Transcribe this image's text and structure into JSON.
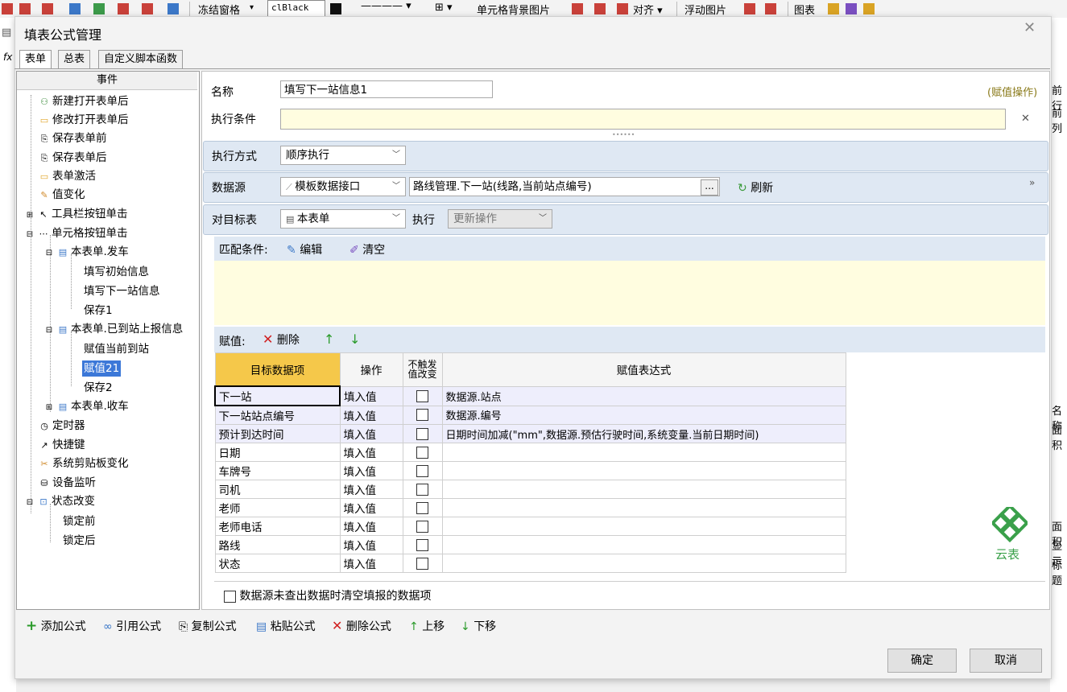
{
  "bg_toolbar": {
    "freeze_label": "冻结窗格",
    "color_value": "clBlack",
    "cell_bg_label": "单元格背景图片",
    "align_label": "对齐",
    "float_img_label": "浮动图片",
    "chart_label": "图表"
  },
  "bg_right": [
    "前行",
    "前列",
    "名称",
    "面积",
    "面积",
    "显示",
    "标题"
  ],
  "dialog": {
    "title": "填表公式管理",
    "tabs": [
      "表单",
      "总表",
      "自定义脚本函数"
    ]
  },
  "tree": {
    "header": "事件",
    "items": [
      {
        "label": "新建打开表单后",
        "icon": "user-add-icon"
      },
      {
        "label": "修改打开表单后",
        "icon": "folder-open-icon"
      },
      {
        "label": "保存表单前",
        "icon": "save-icon"
      },
      {
        "label": "保存表单后",
        "icon": "save-icon"
      },
      {
        "label": "表单激活",
        "icon": "folder-icon"
      },
      {
        "label": "值变化",
        "icon": "edit-icon"
      },
      {
        "label": "工具栏按钮单击",
        "icon": "cursor-icon"
      },
      {
        "label": "单元格按钮单击",
        "icon": "ellipsis-icon"
      },
      {
        "label": "本表单.发车",
        "icon": "form-icon"
      },
      {
        "label": "填写初始信息",
        "icon": ""
      },
      {
        "label": "填写下一站信息",
        "icon": ""
      },
      {
        "label": "保存1",
        "icon": ""
      },
      {
        "label": "本表单.已到站上报信息",
        "icon": "form-icon"
      },
      {
        "label": "赋值当前到站",
        "icon": ""
      },
      {
        "label": "赋值21",
        "icon": ""
      },
      {
        "label": "保存2",
        "icon": ""
      },
      {
        "label": "本表单.收车",
        "icon": "form-icon"
      },
      {
        "label": "定时器",
        "icon": "timer-icon"
      },
      {
        "label": "快捷键",
        "icon": "shortcut-icon"
      },
      {
        "label": "系统剪贴板变化",
        "icon": "scissors-icon"
      },
      {
        "label": "设备监听",
        "icon": "device-icon"
      },
      {
        "label": "状态改变",
        "icon": "state-icon"
      },
      {
        "label": "锁定前",
        "icon": ""
      },
      {
        "label": "锁定后",
        "icon": ""
      }
    ]
  },
  "form": {
    "name_label": "名称",
    "name_value": "填写下一站信息1",
    "assign_op_label": "(赋值操作)",
    "cond_label": "执行条件",
    "cond_value": "",
    "exec_mode_label": "执行方式",
    "exec_mode_value": "顺序执行",
    "datasource_label": "数据源",
    "datasource_type": "模板数据接口",
    "datasource_value": "路线管理.下一站(线路,当前站点编号)",
    "refresh_label": "刷新",
    "target_label": "对目标表",
    "target_value": "本表单",
    "exec_label": "执行",
    "exec_value": "更新操作",
    "match_label": "匹配条件:",
    "edit_label": "编辑",
    "clear_label": "清空",
    "assign_label": "赋值:",
    "delete_label": "删除",
    "clear_checkbox_label": "数据源未查出数据时清空填报的数据项"
  },
  "grid": {
    "headers": [
      "目标数据项",
      "操作",
      "不触发值改变",
      "赋值表达式"
    ],
    "rows": [
      {
        "target": "下一站",
        "op": "填入值",
        "expr": "数据源.站点"
      },
      {
        "target": "下一站站点编号",
        "op": "填入值",
        "expr": "数据源.编号"
      },
      {
        "target": "预计到达时间",
        "op": "填入值",
        "expr": "日期时间加减(\"mm\",数据源.预估行驶时间,系统变量.当前日期时间)"
      },
      {
        "target": "日期",
        "op": "填入值",
        "expr": ""
      },
      {
        "target": "车牌号",
        "op": "填入值",
        "expr": ""
      },
      {
        "target": "司机",
        "op": "填入值",
        "expr": ""
      },
      {
        "target": "老师",
        "op": "填入值",
        "expr": ""
      },
      {
        "target": "老师电话",
        "op": "填入值",
        "expr": ""
      },
      {
        "target": "路线",
        "op": "填入值",
        "expr": ""
      },
      {
        "target": "状态",
        "op": "填入值",
        "expr": ""
      }
    ]
  },
  "logo_text": "云表",
  "bottom_toolbar": {
    "add": "添加公式",
    "ref": "引用公式",
    "copy": "复制公式",
    "paste": "粘贴公式",
    "delete": "删除公式",
    "up": "上移",
    "down": "下移"
  },
  "buttons": {
    "ok": "确定",
    "cancel": "取消"
  }
}
